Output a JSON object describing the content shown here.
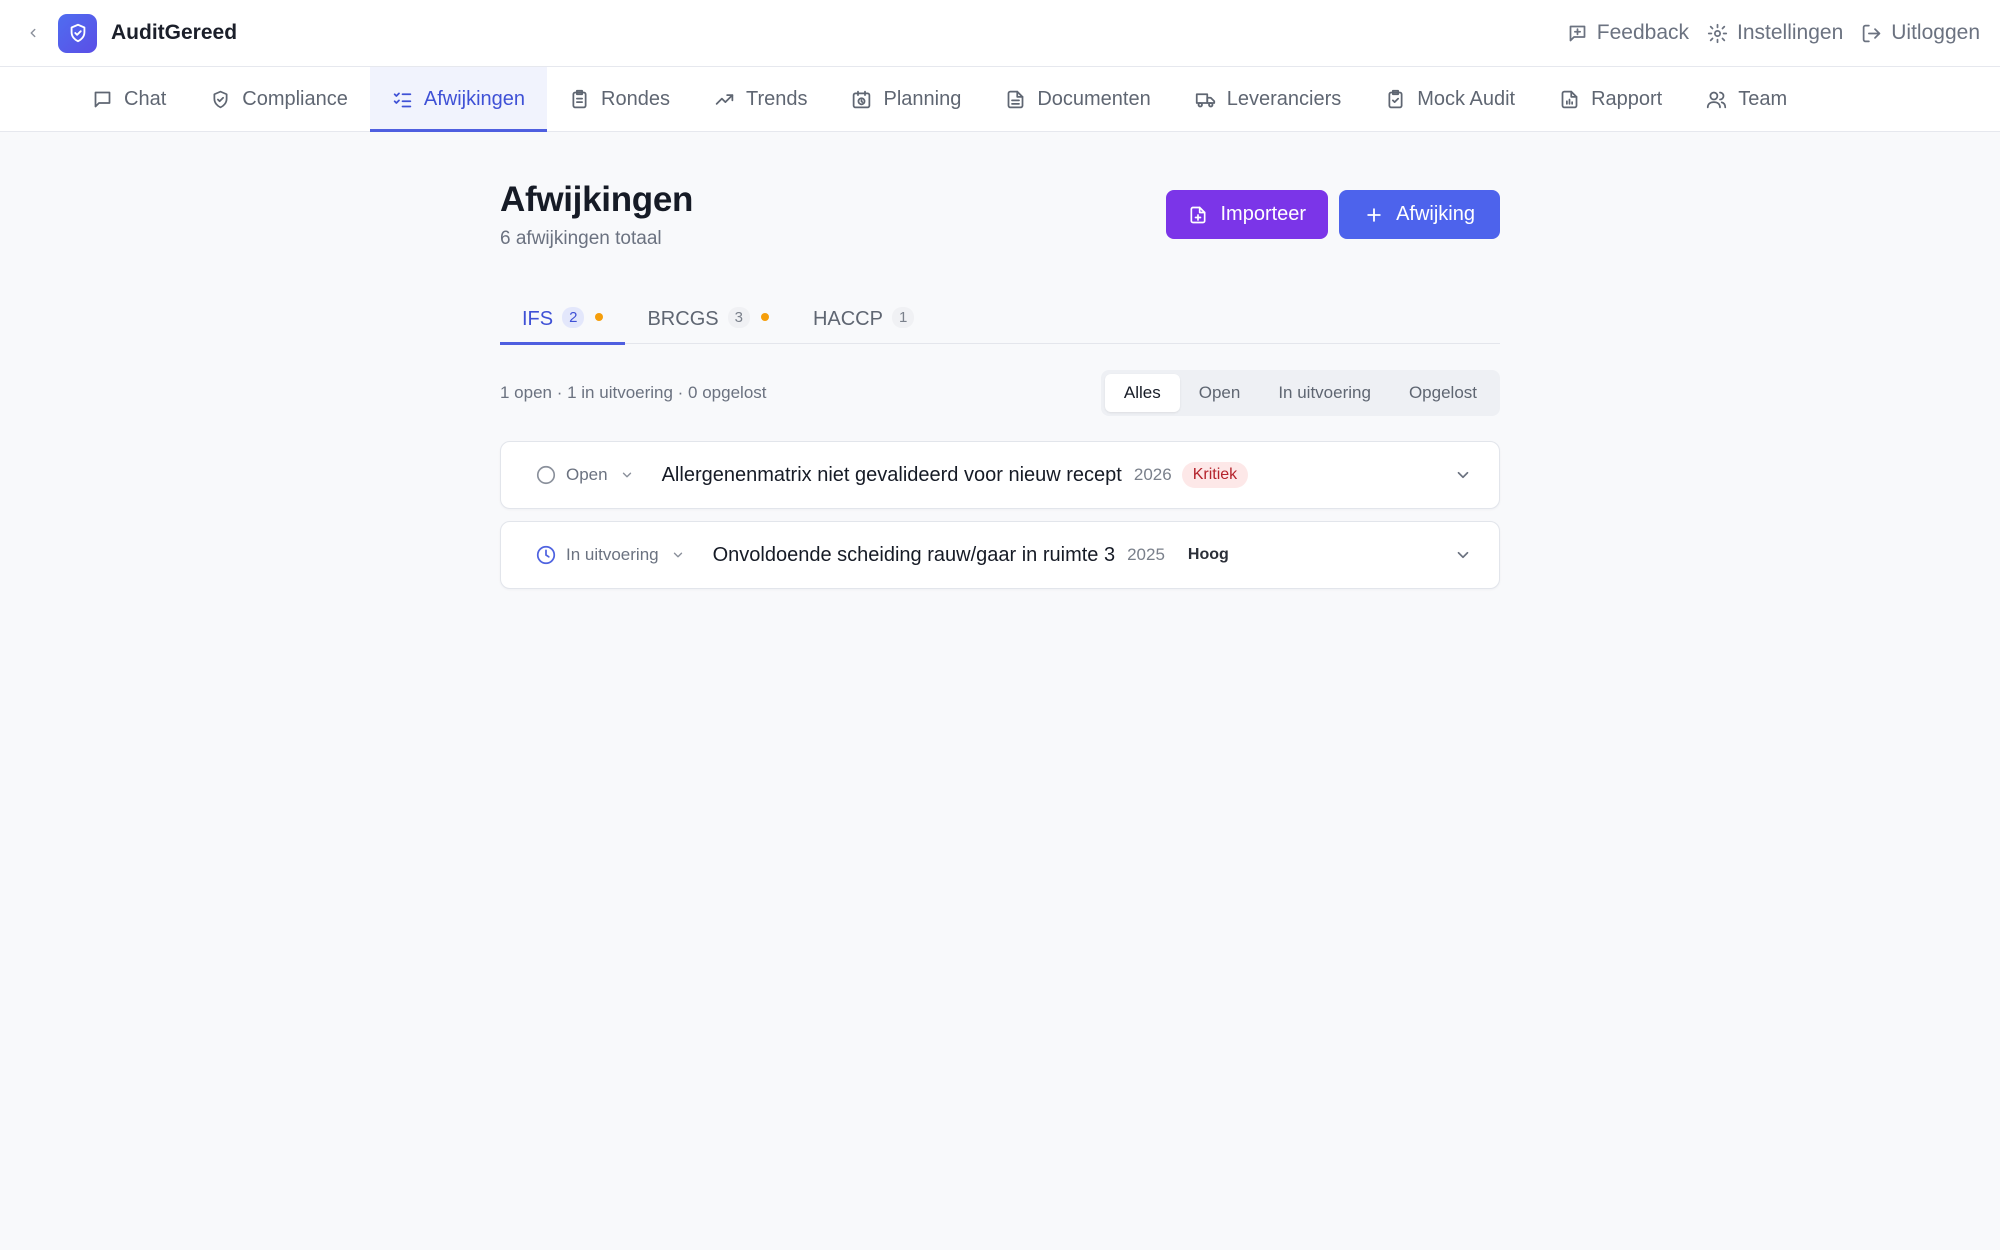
{
  "app": {
    "title": "AuditGereed"
  },
  "header_links": {
    "feedback": "Feedback",
    "settings": "Instellingen",
    "logout": "Uitloggen"
  },
  "nav": {
    "items": [
      {
        "label": "Chat",
        "icon": "chat-icon"
      },
      {
        "label": "Compliance",
        "icon": "shield-check-icon"
      },
      {
        "label": "Afwijkingen",
        "icon": "list-checks-icon",
        "active": true
      },
      {
        "label": "Rondes",
        "icon": "clipboard-icon"
      },
      {
        "label": "Trends",
        "icon": "trending-up-icon"
      },
      {
        "label": "Planning",
        "icon": "calendar-clock-icon"
      },
      {
        "label": "Documenten",
        "icon": "document-icon"
      },
      {
        "label": "Leveranciers",
        "icon": "truck-icon"
      },
      {
        "label": "Mock Audit",
        "icon": "clipboard-check-icon"
      },
      {
        "label": "Rapport",
        "icon": "report-icon"
      },
      {
        "label": "Team",
        "icon": "users-icon"
      }
    ]
  },
  "page": {
    "title": "Afwijkingen",
    "subtitle": "6 afwijkingen totaal",
    "import_label": "Importeer",
    "add_label": "Afwijking"
  },
  "standards": [
    {
      "label": "IFS",
      "count": "2",
      "dot": true,
      "active": true
    },
    {
      "label": "BRCGS",
      "count": "3",
      "dot": true,
      "active": false
    },
    {
      "label": "HACCP",
      "count": "1",
      "dot": false,
      "active": false
    }
  ],
  "summary": "1 open · 1 in uitvoering · 0 opgelost",
  "filters": [
    {
      "label": "Alles",
      "active": true
    },
    {
      "label": "Open",
      "active": false
    },
    {
      "label": "In uitvoering",
      "active": false
    },
    {
      "label": "Opgelost",
      "active": false
    }
  ],
  "items": [
    {
      "status": "Open",
      "status_icon": "circle-icon",
      "title": "Allergenenmatrix niet gevalideerd voor nieuw recept",
      "year": "2026",
      "severity": "Kritiek"
    },
    {
      "status": "In uitvoering",
      "status_icon": "clock-icon",
      "title": "Onvoldoende scheiding rauw/gaar in ruimte 3",
      "year": "2025",
      "severity": "Hoog"
    }
  ],
  "colors": {
    "accent": "#4f5fe0",
    "import_button": "#7b35e8",
    "add_button": "#4d63ec",
    "critical_bg": "#fde8e8",
    "critical_text": "#b4232c",
    "dot": "#f59e0b"
  }
}
